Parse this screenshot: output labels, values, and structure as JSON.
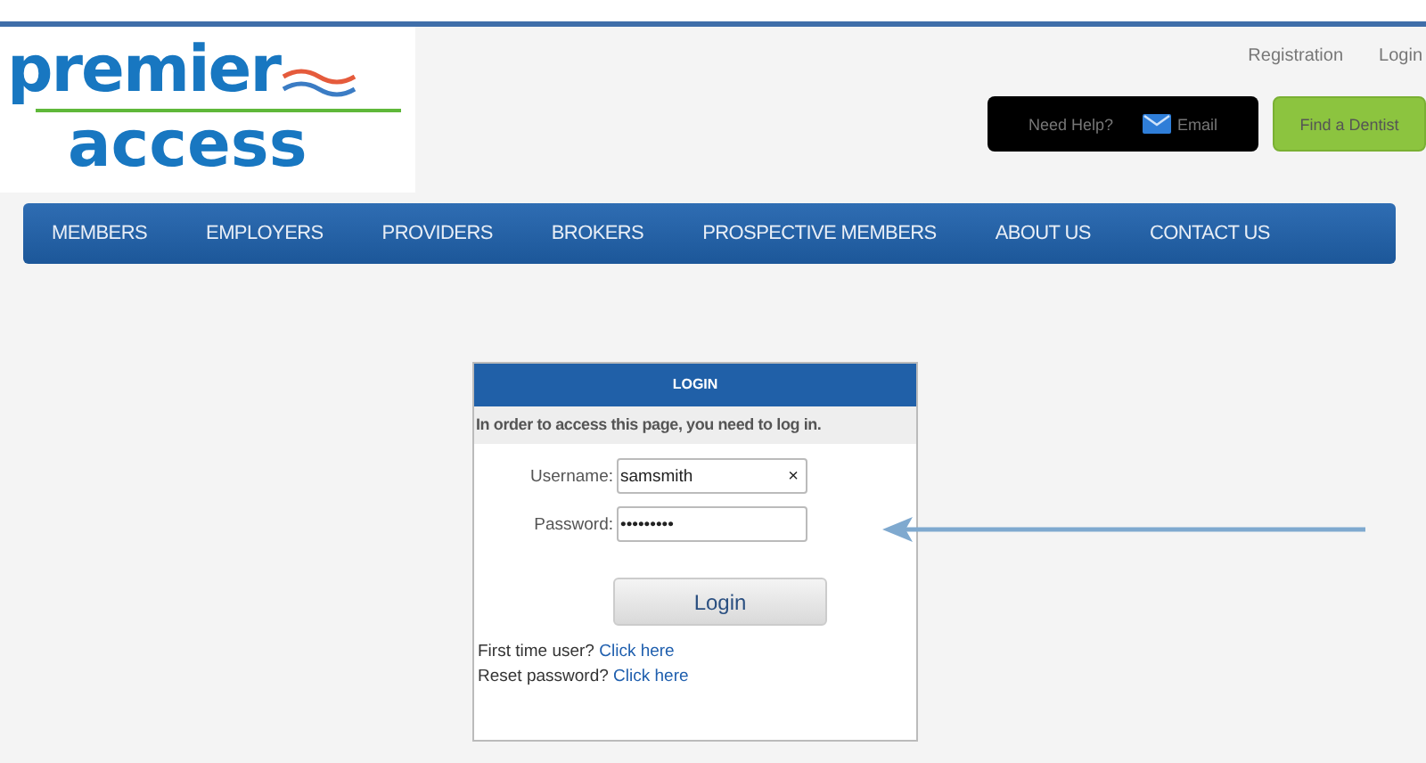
{
  "logo": {
    "line_1": "premier",
    "line_2": "access"
  },
  "top_links": [
    "Registration",
    "Login"
  ],
  "help_bar": {
    "label": "Need Help?",
    "email": "Email"
  },
  "find_button": "Find a Dentist",
  "nav": [
    "MEMBERS",
    "EMPLOYERS",
    "PROVIDERS",
    "BROKERS",
    "PROSPECTIVE MEMBERS",
    "ABOUT US",
    "CONTACT US"
  ],
  "login_box": {
    "title": "LOGIN",
    "message": "In order to access this page, you need to log in.",
    "fields": [
      {
        "label": "Username:",
        "value": "samsmith",
        "clear": "×"
      },
      {
        "label": "Password:",
        "value": "•••••••••"
      }
    ],
    "button": "Login",
    "links": [
      {
        "text": "First time user?",
        "link": "Click here"
      },
      {
        "text": "Reset password?",
        "link": "Click here"
      }
    ]
  }
}
